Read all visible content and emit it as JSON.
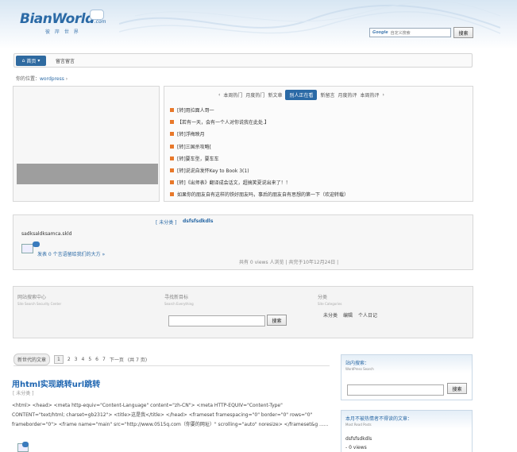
{
  "header": {
    "logo_text": "BianWorld",
    "logo_suffix": ".com",
    "logo_tagline": "彼 岸 世 界",
    "google_label": "Google",
    "search_placeholder": "自定义搜索",
    "search_button": "搜索"
  },
  "nav": {
    "home_label": "首页",
    "item": "留言留言"
  },
  "breadcrumb": {
    "prefix": "你的位置：",
    "link": "wordpress",
    "sep": "›"
  },
  "tabs": {
    "prev": "‹",
    "items": [
      "本周热门",
      "月度热门",
      "新文章"
    ],
    "active": "别人正在看",
    "rest": [
      "新留言",
      "月度热评",
      "本周热评"
    ],
    "next": "›"
  },
  "news": [
    "[转]用拉面人哥一",
    "【若有一天，会有一个人对你说我在此处.】",
    "[转]浮梅映月",
    "[转]三国杀攻略[",
    "[转]要车型，要车车",
    "[转]说说自发怀Key to Book 3(1)",
    "[转]《出师表》翻译成会话文，超搞笑夏说出来了！！",
    "如果你的朋友自有这样的铁好朋友吗，事后的朋友自有思想的第一下（欢迎转载）"
  ],
  "post": {
    "category": "[ 未分类 ]",
    "title": "dsfsfsdkdls",
    "excerpt": "sadksaldksamca.skld",
    "comment_text": "发表 0 个言语留给我们的大方 »",
    "meta": "共有 0 views 人浏览 | 共完于10年12月24日 |"
  },
  "search_section": {
    "col1_title": "网站搜索中心",
    "col1_sub": "Site Search Security Center",
    "col2_title": "寻找新目标",
    "col2_sub": "Search Everything",
    "col3_title": "分类",
    "col3_sub": "Site Categories",
    "links": [
      "未分类",
      "编辑",
      "个人日记"
    ],
    "button": "搜索"
  },
  "pager": {
    "newest": "新世代的文章",
    "pages": [
      "1",
      "2",
      "3",
      "4",
      "5",
      "6",
      "7"
    ],
    "next": "下一页",
    "total": "(共 7 页)"
  },
  "article": {
    "title": "用html实现跳转url跳转",
    "category": "[ 未分类 ]",
    "body": "<html> <head> <meta http-equiv=\"Content-Language\" content=\"zh-CN\"> <meta HTTP-EQUIV=\"Content-Type\" CONTENT=\"text/html; charset=gb2312\"> <title>这是我</title> </head> <frameset framespacing=\"0\" border=\"0\" rows=\"0\" frameborder=\"0\"> <frame name=\"main\" src=\"http://www.0515q.com（你要的网址）\" scrolling=\"auto\" noresize> </frameset&g ......"
  },
  "sidebar": {
    "box1_title": "站内搜索：",
    "box1_sub": "WordPress Search",
    "box1_button": "搜索",
    "box2_title": "本月不被热情者不得读的文章：",
    "box2_sub": "Most Read Posts",
    "box2_items": [
      "dsfsfsdkdls",
      "- 0 views"
    ]
  },
  "colors": {
    "accent": "#2b6aa6",
    "bullet": "#e8782a"
  }
}
